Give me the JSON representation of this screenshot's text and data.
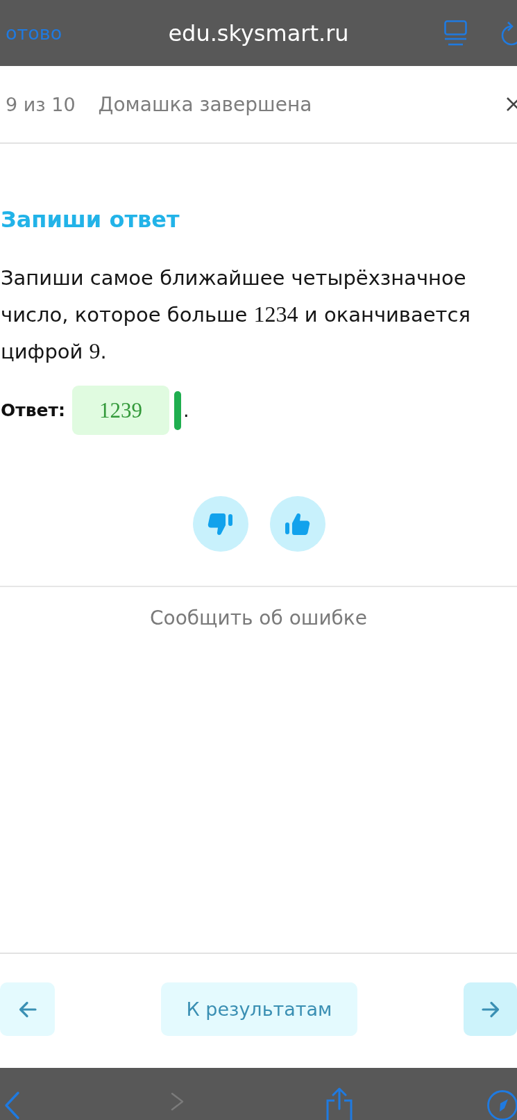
{
  "browser_bar": {
    "done_label": "отово",
    "url": "edu.skysmart.ru"
  },
  "header": {
    "progress": "9 из 10",
    "status": "Домашка завершена"
  },
  "task": {
    "title": "Запиши ответ",
    "text": [
      {
        "kind": "text",
        "text": "Запиши самое ближайшее четырёхзначное число, которое больше "
      },
      {
        "kind": "math",
        "text": "1234"
      },
      {
        "kind": "text",
        "text": " и оканчивается цифрой "
      },
      {
        "kind": "math",
        "text": "9"
      },
      {
        "kind": "text",
        "text": "."
      }
    ],
    "answer": {
      "label": "Ответ:",
      "value": "1239",
      "correct": true,
      "suffix": "."
    }
  },
  "report_link": "Сообщить об ошибке",
  "navigation": {
    "results_button": "К результатам"
  },
  "toolbar": [
    {
      "kind": "back",
      "disabled": false
    },
    {
      "kind": "forward",
      "disabled": true
    },
    {
      "kind": "share",
      "disabled": false
    },
    {
      "kind": "compass",
      "disabled": false
    }
  ]
}
